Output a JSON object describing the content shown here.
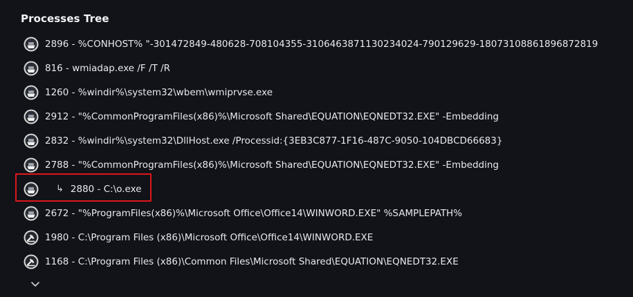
{
  "panel": {
    "title": "Processes Tree"
  },
  "processes": [
    {
      "text": "2896 - %CONHOST% \"-301472849-480628-708104355-3106463871130234024-790129629-18073108861896872819",
      "icon": "generic-process-icon",
      "child": false
    },
    {
      "text": "816 - wmiadap.exe /F /T /R",
      "icon": "generic-process-icon",
      "child": false
    },
    {
      "text": "1260 - %windir%\\system32\\wbem\\wmiprvse.exe",
      "icon": "generic-process-icon",
      "child": false
    },
    {
      "text": "2912 - \"%CommonProgramFiles(x86)%\\Microsoft Shared\\EQUATION\\EQNEDT32.EXE\" -Embedding",
      "icon": "generic-process-icon",
      "child": false
    },
    {
      "text": "2832 - %windir%\\system32\\DllHost.exe /Processid:{3EB3C877-1F16-487C-9050-104DBCD66683}",
      "icon": "generic-process-icon",
      "child": false
    },
    {
      "text": "2788 - \"%CommonProgramFiles(x86)%\\Microsoft Shared\\EQUATION\\EQNEDT32.EXE\" -Embedding",
      "icon": "generic-process-icon",
      "child": false
    },
    {
      "text": "2880 - C:\\o.exe",
      "icon": "generic-process-icon",
      "child": true,
      "arrow": "↳"
    },
    {
      "text": "2672 - \"%ProgramFiles(x86)%\\Microsoft Office\\Office14\\WINWORD.EXE\" %SAMPLEPATH%",
      "icon": "generic-process-icon",
      "child": false
    },
    {
      "text": "1980 - C:\\Program Files (x86)\\Microsoft Office\\Office14\\WINWORD.EXE",
      "icon": "hammer-icon",
      "child": false
    },
    {
      "text": "1168 - C:\\Program Files (x86)\\Common Files\\Microsoft Shared\\EQUATION\\EQNEDT32.EXE",
      "icon": "hammer-icon",
      "child": false
    }
  ],
  "more_icon": "chevron-down-icon",
  "colors": {
    "background": "#111318",
    "text": "#e8eaee",
    "highlight": "#e0161b",
    "icon_bg": "#dcdcdc"
  }
}
